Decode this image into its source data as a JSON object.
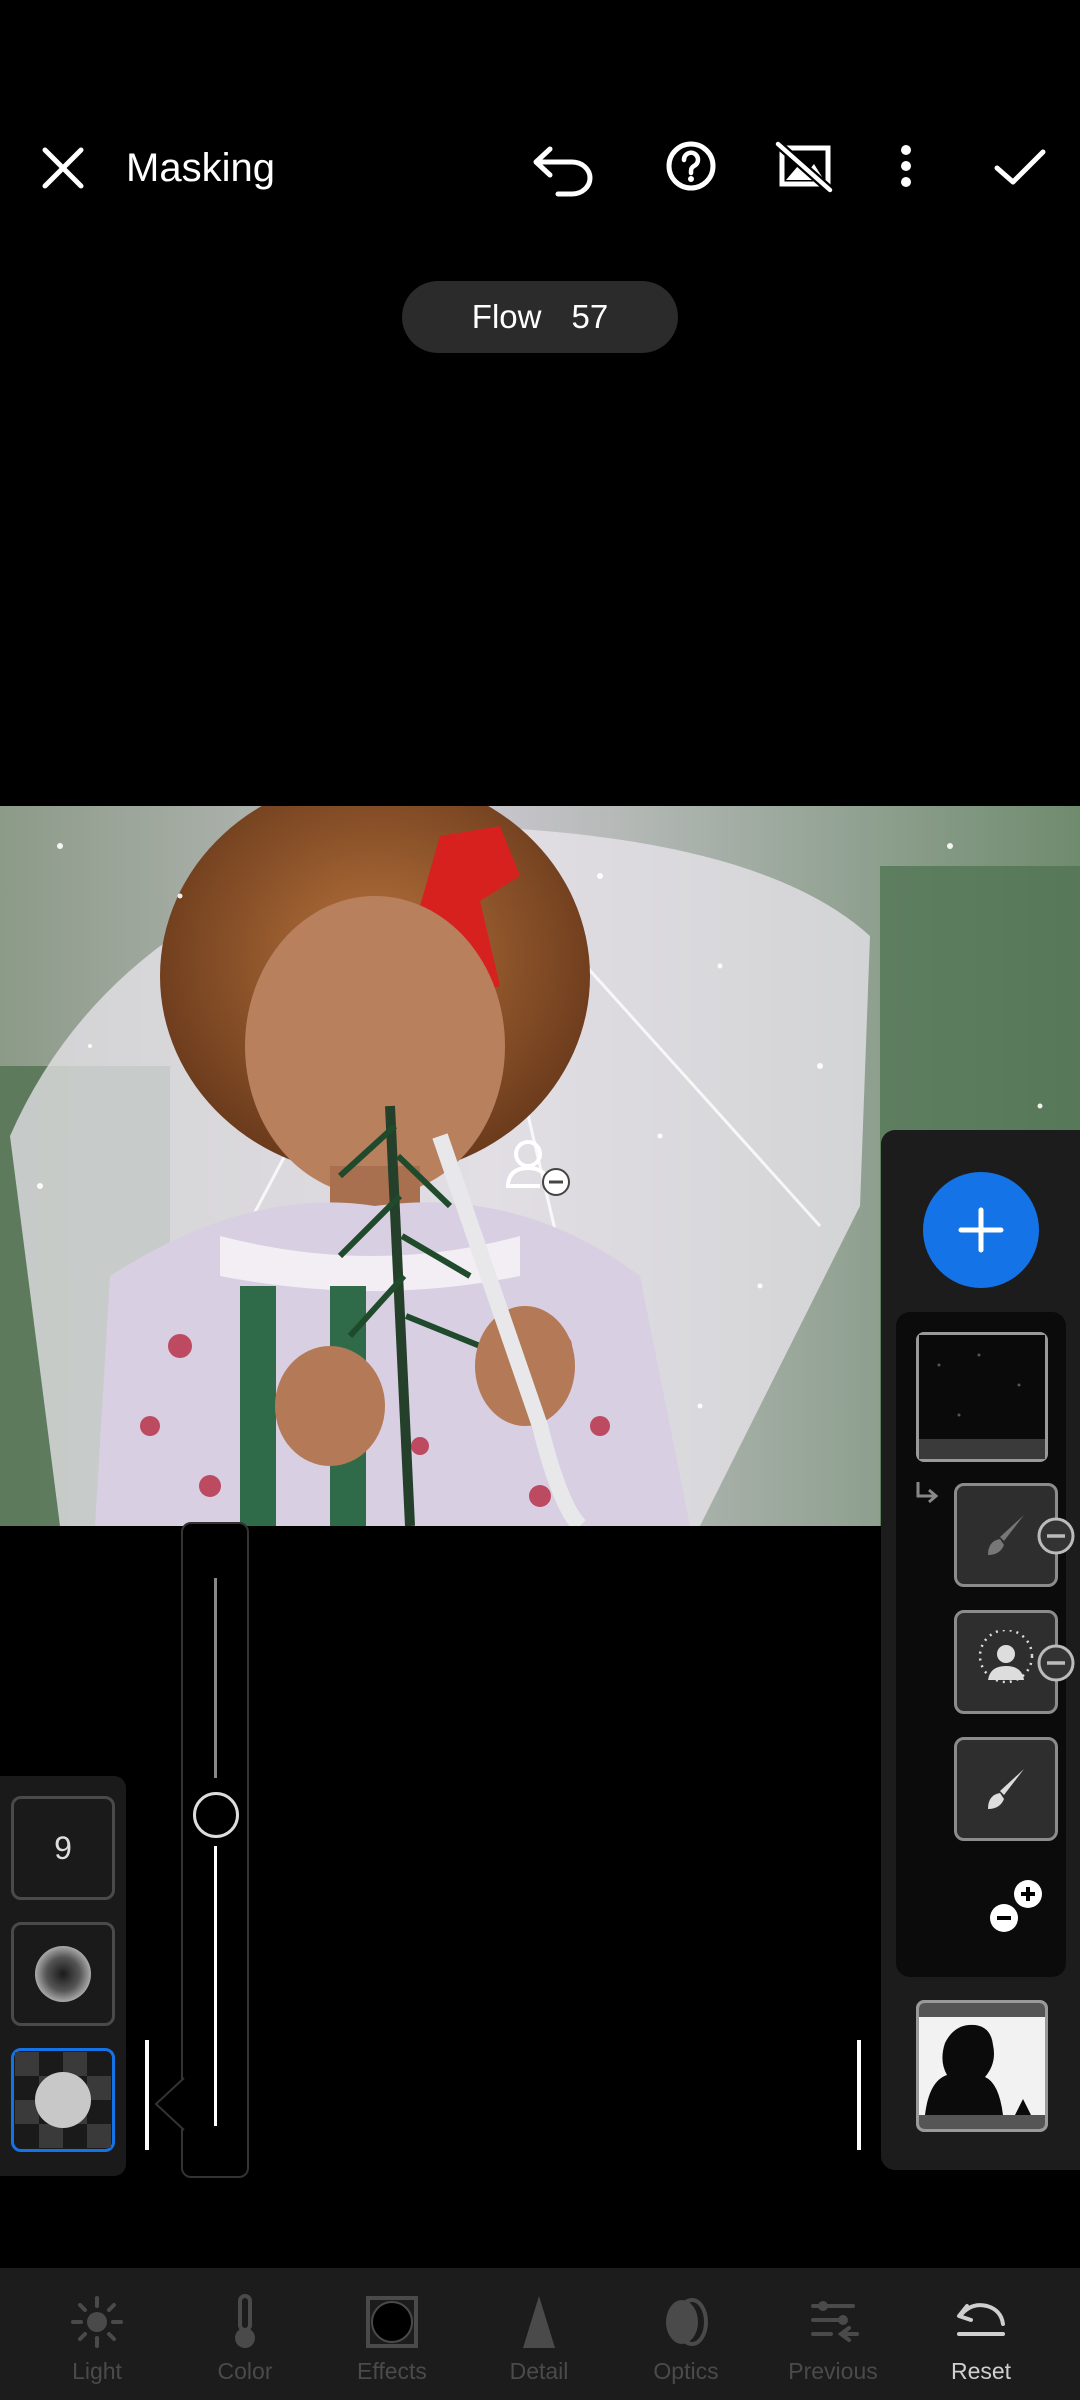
{
  "header": {
    "title": "Masking"
  },
  "flow": {
    "label": "Flow",
    "value": "57"
  },
  "brush": {
    "size_value": "9"
  },
  "toolbar": {
    "items": [
      {
        "label": "Light",
        "icon": "sun-icon",
        "active": false
      },
      {
        "label": "Color",
        "icon": "thermometer-icon",
        "active": false
      },
      {
        "label": "Effects",
        "icon": "vignette-icon",
        "active": false
      },
      {
        "label": "Detail",
        "icon": "triangle-icon",
        "active": false
      },
      {
        "label": "Optics",
        "icon": "lens-icon",
        "active": false
      },
      {
        "label": "Previous",
        "icon": "previous-icon",
        "active": false
      },
      {
        "label": "Reset",
        "icon": "reset-icon",
        "active": true
      }
    ]
  },
  "colors": {
    "accent": "#1473e6",
    "panel": "#1c1c1c"
  }
}
